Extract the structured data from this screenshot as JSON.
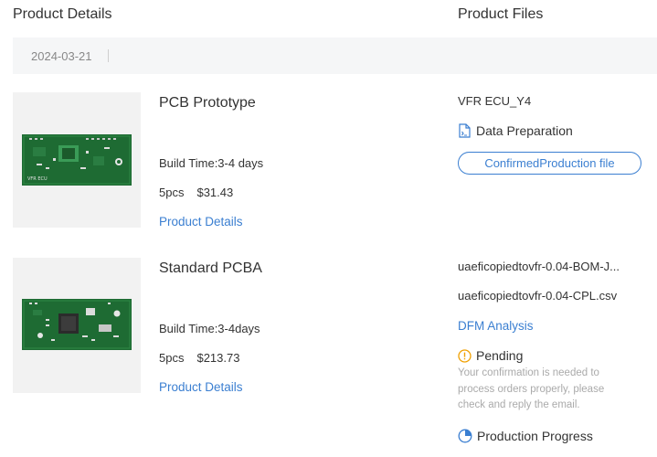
{
  "header": {
    "left_title": "Product Details",
    "right_title": "Product Files"
  },
  "order": {
    "date": "2024-03-21"
  },
  "products": [
    {
      "title": "PCB Prototype",
      "build_time": "Build Time:3-4 days",
      "qty": "5pcs",
      "price": "$31.43",
      "details_link": "Product Details"
    },
    {
      "title": "Standard PCBA",
      "build_time": "Build Time:3-4days",
      "qty": "5pcs",
      "price": "$213.73",
      "details_link": "Product Details"
    }
  ],
  "files": {
    "pcb": {
      "filename": "VFR ECU_Y4",
      "status": "Data Preparation",
      "status_icon": "file-data-icon",
      "action_button": "ConfirmedProduction file"
    },
    "pcba": {
      "bom_file": "uaeficopiedtovfr-0.04-BOM-J...",
      "cpl_file": "uaeficopiedtovfr-0.04-CPL.csv",
      "dfm_link": "DFM Analysis",
      "pending_status": "Pending",
      "pending_icon": "exclamation-circle-icon",
      "pending_note": "Your confirmation is needed to process orders properly, please check and reply the email.",
      "progress_status": "Production Progress",
      "progress_icon": "progress-circle-icon"
    }
  },
  "colors": {
    "link": "#3b7fd1",
    "pending": "#f0a000",
    "pcb_green": "#1e6b33",
    "thumb_bg": "#f2f2f2",
    "datebar_bg": "#f5f6f7"
  }
}
